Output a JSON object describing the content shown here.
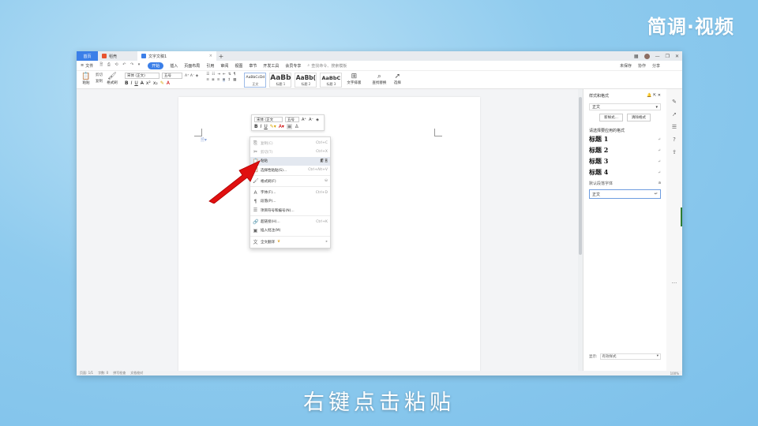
{
  "watermark": "简调·视频",
  "subtitle": "右键点击粘贴",
  "tabs": {
    "home": "首页",
    "t1": "稻壳",
    "t2": "文字文稿1",
    "close": "×",
    "new": "+"
  },
  "window_controls": {
    "minimize": "—",
    "restore": "❐",
    "close": "✕"
  },
  "menubar": {
    "file": "文件",
    "quick_access": "🗎 ⎙ ⟲ ↶ ↷ ▾",
    "items": [
      "开始",
      "插入",
      "页面布局",
      "引用",
      "审阅",
      "视图",
      "章节",
      "开发工具",
      "会员专享"
    ],
    "search_placeholder": "查找命令、搜索模板",
    "right": [
      "未保存",
      "协作",
      "分享"
    ]
  },
  "ribbon": {
    "paste": "粘贴",
    "cut": "剪切",
    "copy": "复制",
    "format_painter": "格式刷",
    "font_name": "宋体 (正文)",
    "font_size": "五号",
    "styles": [
      {
        "sample": "AaBbCcDd",
        "name": "正文"
      },
      {
        "sample": "AaBb",
        "name": "标题 1"
      },
      {
        "sample": "AaBb(",
        "name": "标题 2"
      },
      {
        "sample": "AaBbC",
        "name": "标题 3"
      }
    ],
    "text_layout": "文字排版",
    "find_replace": "查找替换",
    "select": "选择"
  },
  "mini_toolbar": {
    "font": "宋体 (正文",
    "size": "五号",
    "grow": "A⁺",
    "shrink": "A⁻",
    "bold": "B",
    "italic": "I",
    "underline": "U",
    "format": "≡"
  },
  "context_menu": [
    {
      "icon": "⎘",
      "label": "复制(C)",
      "shortcut": "Ctrl+C",
      "disabled": true
    },
    {
      "icon": "✂",
      "label": "剪切(T)",
      "shortcut": "Ctrl+X",
      "disabled": true
    },
    {
      "icon": "📋",
      "label": "粘贴",
      "shortcut": "",
      "highlight": true
    },
    {
      "icon": "📋",
      "label": "选择性粘贴(S)...",
      "shortcut": "Ctrl+Alt+V"
    },
    {
      "icon": "🖌",
      "label": "格式刷(F)",
      "shortcut": ""
    },
    {
      "icon": "A",
      "label": "字体(F)...",
      "shortcut": "Ctrl+D"
    },
    {
      "icon": "¶",
      "label": "段落(P)...",
      "shortcut": ""
    },
    {
      "icon": "☰",
      "label": "项目符号和编号(N)...",
      "shortcut": ""
    },
    {
      "icon": "🔗",
      "label": "超链接(H)...",
      "shortcut": "Ctrl+K"
    },
    {
      "icon": "▣",
      "label": "插入批注(M)",
      "shortcut": ""
    },
    {
      "icon": "文",
      "label": "全文翻译",
      "shortcut": ""
    }
  ],
  "right_panel": {
    "title": "样式和格式",
    "current_style": "正文",
    "new_style": "新样式...",
    "clear_format": "清除格式",
    "apply_label": "请选择要应用的格式",
    "headings": [
      "标题 1",
      "标题 2",
      "标题 3",
      "标题 4"
    ],
    "default_font": "默认段落字体",
    "current": "正文",
    "show_label": "显示:",
    "show_value": "有效样式"
  },
  "statusbar": {
    "page": "页面: 1/1",
    "words": "字数: 0",
    "spell": "拼写检查",
    "doc_check": "文档校对",
    "zoom": "100%"
  },
  "colors": {
    "accent": "#3b7fe8",
    "arrow": "#e01010"
  }
}
